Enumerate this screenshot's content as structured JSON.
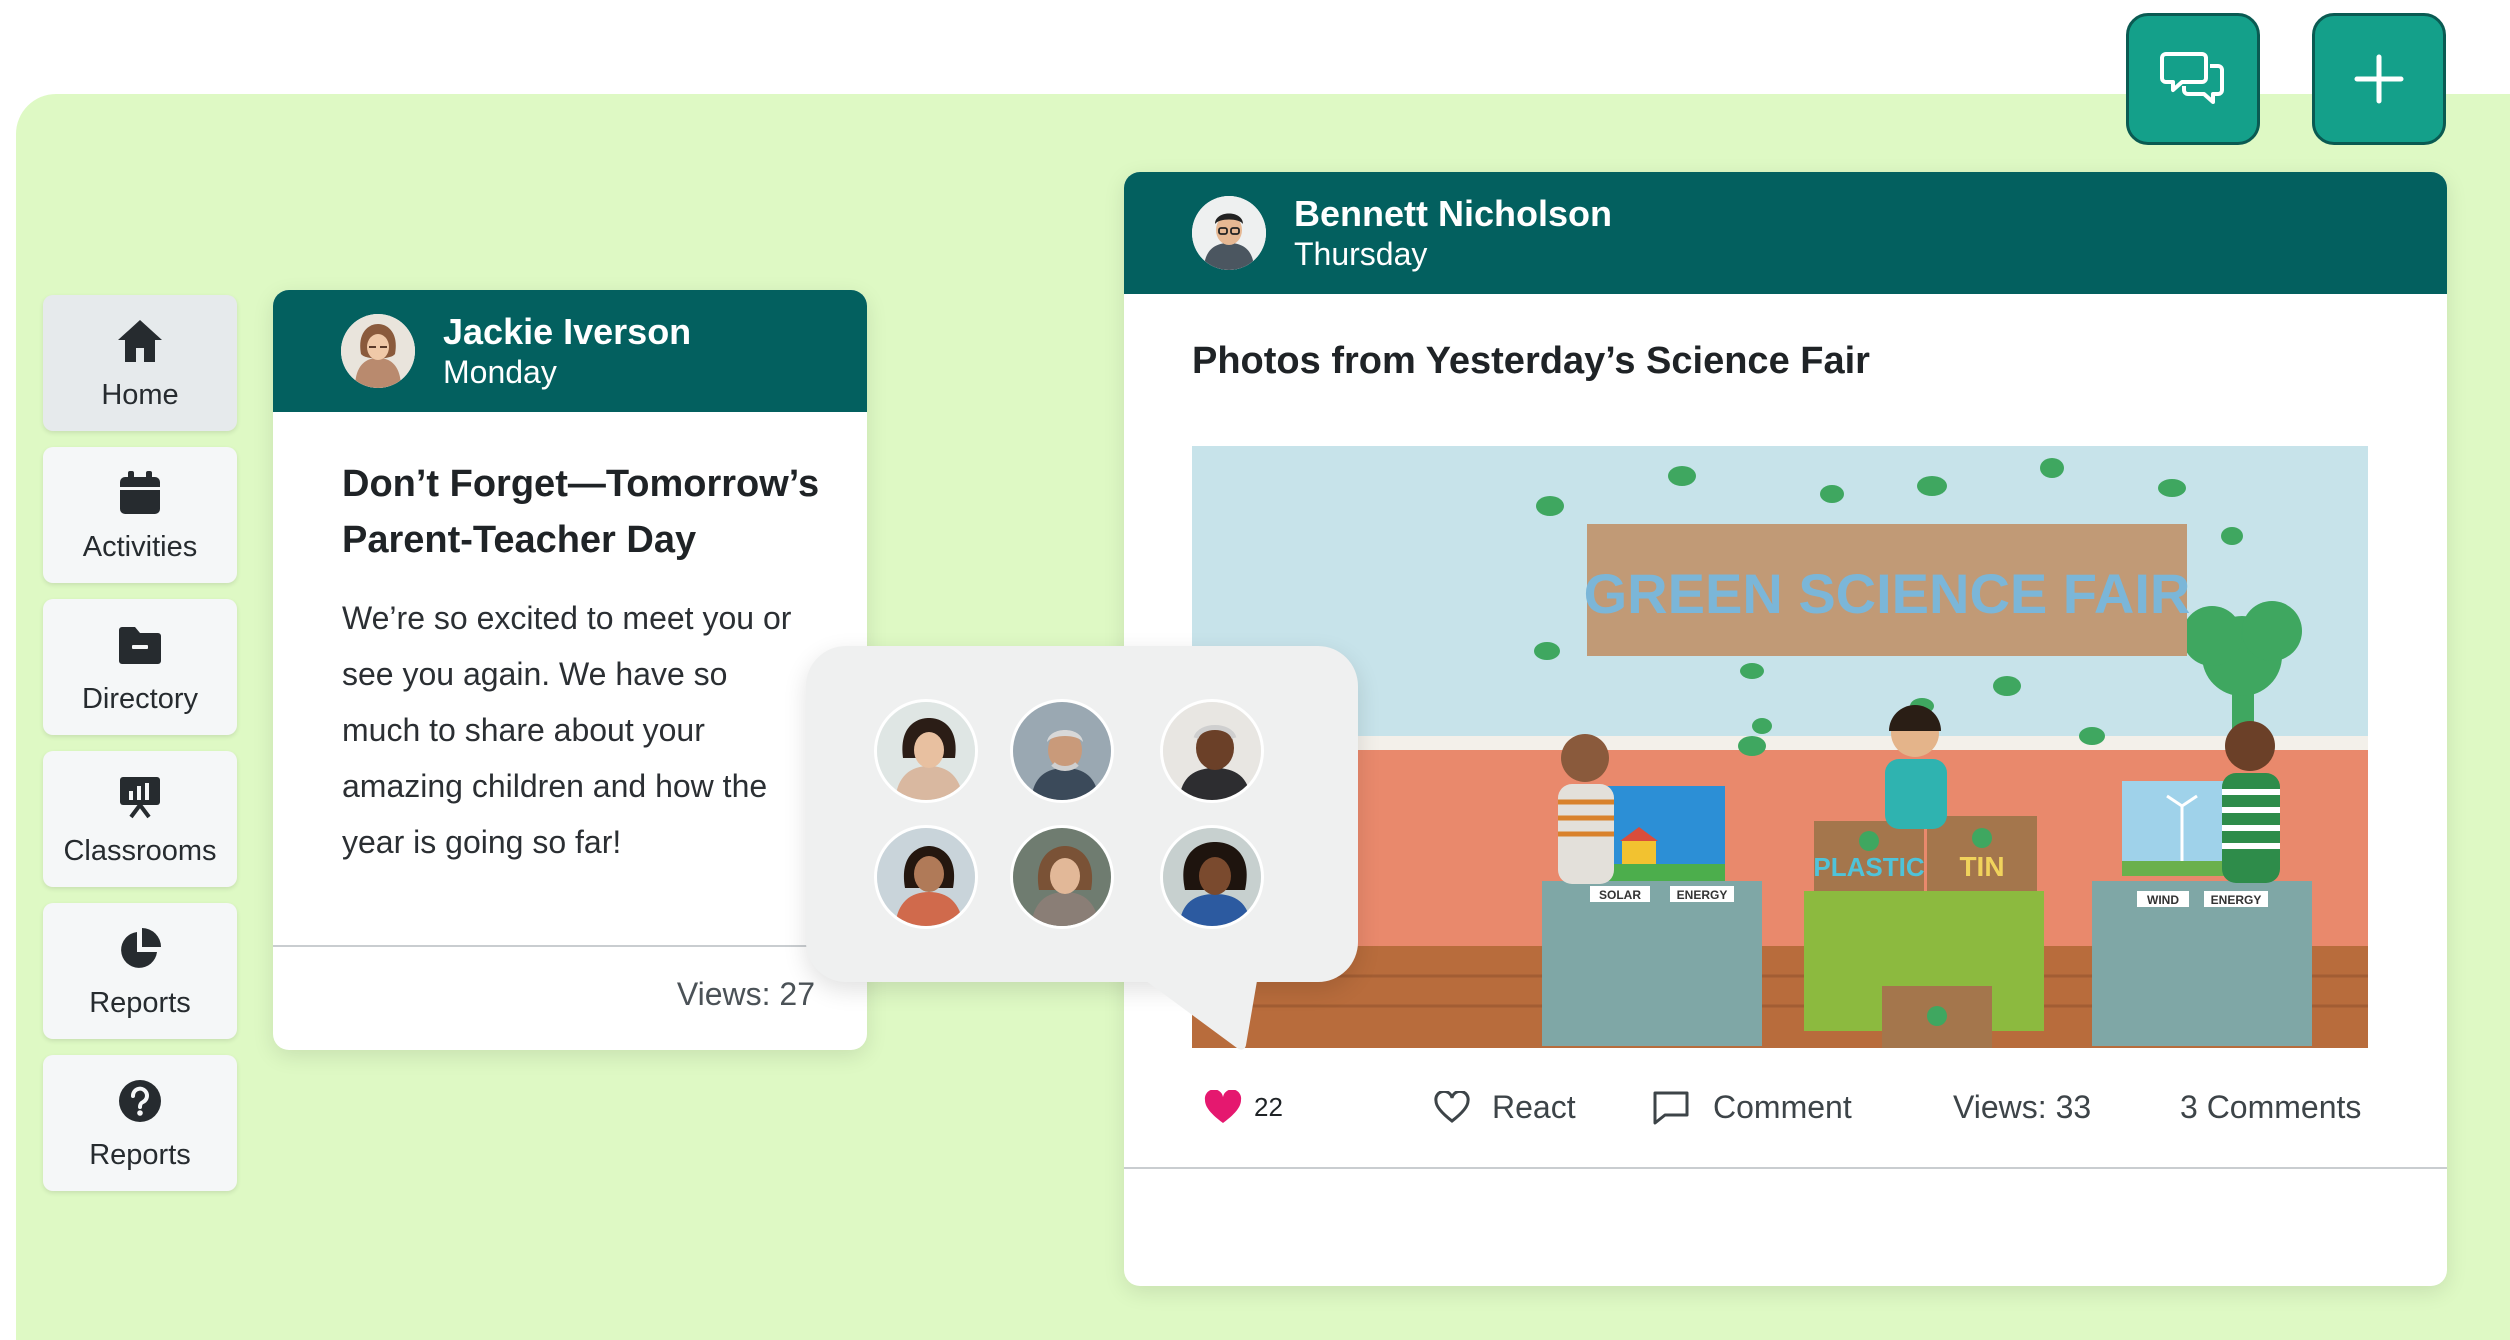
{
  "toolbar": {
    "chat_icon": "chat-bubbles-icon",
    "add_icon": "plus-icon"
  },
  "sidebar": {
    "items": [
      {
        "label": "Home",
        "icon": "home-icon",
        "active": true
      },
      {
        "label": "Activities",
        "icon": "calendar-icon"
      },
      {
        "label": "Directory",
        "icon": "folder-icon"
      },
      {
        "label": "Classrooms",
        "icon": "presentation-icon"
      },
      {
        "label": "Reports",
        "icon": "pie-chart-icon"
      },
      {
        "label": "Reports",
        "icon": "question-icon"
      }
    ]
  },
  "post_small": {
    "author": "Jackie Iverson",
    "day": "Monday",
    "title": "Don’t Forget—Tomorrow’s Parent-Teacher Day",
    "body": "We’re so excited to meet you or see you again. We have so much to share about your amazing children and how the year is going so far!",
    "views": "Views: 27"
  },
  "post_large": {
    "author": "Bennett Nicholson",
    "day": "Thursday",
    "title": "Photos from Yesterday’s Science Fair",
    "photo": {
      "banner": "GREEN SCIENCE FAIR",
      "sign_plastic": "PLASTIC",
      "sign_tin": "TIN",
      "label_solar": "SOLAR",
      "label_energy_left": "ENERGY",
      "label_wind": "WIND",
      "label_energy_right": "ENERGY"
    },
    "likes": "22",
    "react_label": "React",
    "comment_label": "Comment",
    "views": "Views: 33",
    "comments_count": "3 Comments"
  },
  "colors": {
    "header_teal": "#03605f",
    "button_teal": "#14a08a",
    "backdrop_green": "#def9c4",
    "heart_pink": "#e5186f"
  }
}
